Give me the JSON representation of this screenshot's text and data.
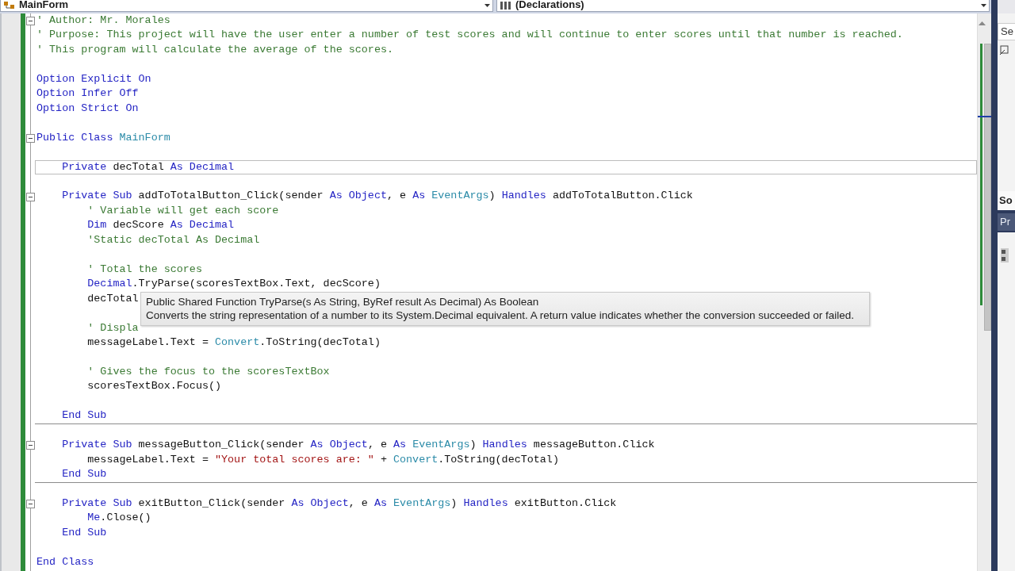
{
  "navigation_bar": {
    "type_combo": "MainForm",
    "member_combo": "(Declarations)"
  },
  "editor": {
    "lines": [
      {
        "kind": "code",
        "expanded": true,
        "tokens": [
          {
            "kind": "comment",
            "text": "' Author: Mr. Morales"
          }
        ]
      },
      {
        "kind": "code",
        "tokens": [
          {
            "kind": "comment",
            "text": "' Purpose: This project will have the user enter a number of test scores and will continue to enter scores until that number is reached."
          }
        ]
      },
      {
        "kind": "code",
        "tokens": [
          {
            "kind": "comment",
            "text": "' This program will calculate the average of the scores."
          }
        ]
      },
      {
        "kind": "blank"
      },
      {
        "kind": "code",
        "tokens": [
          {
            "kind": "keyword",
            "text": "Option Explicit On"
          }
        ]
      },
      {
        "kind": "code",
        "tokens": [
          {
            "kind": "keyword",
            "text": "Option Infer Off"
          }
        ]
      },
      {
        "kind": "code",
        "tokens": [
          {
            "kind": "keyword",
            "text": "Option Strict On"
          }
        ]
      },
      {
        "kind": "blank"
      },
      {
        "kind": "code",
        "expanded": true,
        "tokens": [
          {
            "kind": "keyword",
            "text": "Public Class "
          },
          {
            "kind": "type",
            "text": "MainForm"
          }
        ]
      },
      {
        "kind": "blank"
      },
      {
        "kind": "code",
        "current": true,
        "tokens": [
          {
            "kind": "keyword",
            "text": "    Private "
          },
          {
            "kind": "plain",
            "text": "decTotal "
          },
          {
            "kind": "keyword",
            "text": "As Decimal"
          }
        ]
      },
      {
        "kind": "blank"
      },
      {
        "kind": "code",
        "expanded": true,
        "tokens": [
          {
            "kind": "keyword",
            "text": "    Private Sub "
          },
          {
            "kind": "plain",
            "text": "addToTotalButton_Click(sender "
          },
          {
            "kind": "keyword",
            "text": "As Object"
          },
          {
            "kind": "plain",
            "text": ", e "
          },
          {
            "kind": "keyword",
            "text": "As "
          },
          {
            "kind": "type",
            "text": "EventArgs"
          },
          {
            "kind": "plain",
            "text": ") "
          },
          {
            "kind": "keyword",
            "text": "Handles "
          },
          {
            "kind": "plain",
            "text": "addToTotalButton.Click"
          }
        ]
      },
      {
        "kind": "code",
        "tokens": [
          {
            "kind": "comment",
            "text": "        ' Variable will get each score"
          }
        ]
      },
      {
        "kind": "code",
        "tokens": [
          {
            "kind": "keyword",
            "text": "        Dim "
          },
          {
            "kind": "plain",
            "text": "decScore "
          },
          {
            "kind": "keyword",
            "text": "As Decimal"
          }
        ]
      },
      {
        "kind": "code",
        "tokens": [
          {
            "kind": "comment",
            "text": "        'Static decTotal As Decimal"
          }
        ]
      },
      {
        "kind": "blank"
      },
      {
        "kind": "code",
        "tokens": [
          {
            "kind": "comment",
            "text": "        ' Total the scores"
          }
        ]
      },
      {
        "kind": "code",
        "tokens": [
          {
            "kind": "keyword",
            "text": "        Decimal"
          },
          {
            "kind": "plain",
            "text": ".TryParse(scoresTextBox.Text, decScore)"
          }
        ]
      },
      {
        "kind": "code",
        "tokens": [
          {
            "kind": "plain",
            "text": "        decTotal"
          }
        ]
      },
      {
        "kind": "blank"
      },
      {
        "kind": "code",
        "tokens": [
          {
            "kind": "comment",
            "text": "        ' Displa"
          }
        ]
      },
      {
        "kind": "code",
        "tokens": [
          {
            "kind": "plain",
            "text": "        messageLabel.Text = "
          },
          {
            "kind": "type",
            "text": "Convert"
          },
          {
            "kind": "plain",
            "text": ".ToString(decTotal)"
          }
        ]
      },
      {
        "kind": "blank"
      },
      {
        "kind": "code",
        "tokens": [
          {
            "kind": "comment",
            "text": "        ' Gives the focus to the scoresTextBox"
          }
        ]
      },
      {
        "kind": "code",
        "tokens": [
          {
            "kind": "plain",
            "text": "        scoresTextBox.Focus()"
          }
        ]
      },
      {
        "kind": "blank"
      },
      {
        "kind": "code",
        "tokens": [
          {
            "kind": "keyword",
            "text": "    End Sub"
          }
        ]
      },
      {
        "kind": "blank",
        "separator": true
      },
      {
        "kind": "code",
        "expanded": true,
        "tokens": [
          {
            "kind": "keyword",
            "text": "    Private Sub "
          },
          {
            "kind": "plain",
            "text": "messageButton_Click(sender "
          },
          {
            "kind": "keyword",
            "text": "As Object"
          },
          {
            "kind": "plain",
            "text": ", e "
          },
          {
            "kind": "keyword",
            "text": "As "
          },
          {
            "kind": "type",
            "text": "EventArgs"
          },
          {
            "kind": "plain",
            "text": ") "
          },
          {
            "kind": "keyword",
            "text": "Handles "
          },
          {
            "kind": "plain",
            "text": "messageButton.Click"
          }
        ]
      },
      {
        "kind": "code",
        "tokens": [
          {
            "kind": "plain",
            "text": "        messageLabel.Text = "
          },
          {
            "kind": "string",
            "text": "\"Your total scores are: \""
          },
          {
            "kind": "plain",
            "text": " + "
          },
          {
            "kind": "type",
            "text": "Convert"
          },
          {
            "kind": "plain",
            "text": ".ToString(decTotal)"
          }
        ]
      },
      {
        "kind": "code",
        "tokens": [
          {
            "kind": "keyword",
            "text": "    End Sub"
          }
        ]
      },
      {
        "kind": "blank",
        "separator": true
      },
      {
        "kind": "code",
        "expanded": true,
        "tokens": [
          {
            "kind": "keyword",
            "text": "    Private Sub "
          },
          {
            "kind": "plain",
            "text": "exitButton_Click(sender "
          },
          {
            "kind": "keyword",
            "text": "As Object"
          },
          {
            "kind": "plain",
            "text": ", e "
          },
          {
            "kind": "keyword",
            "text": "As "
          },
          {
            "kind": "type",
            "text": "EventArgs"
          },
          {
            "kind": "plain",
            "text": ") "
          },
          {
            "kind": "keyword",
            "text": "Handles "
          },
          {
            "kind": "plain",
            "text": "exitButton.Click"
          }
        ]
      },
      {
        "kind": "code",
        "tokens": [
          {
            "kind": "keyword",
            "text": "        Me"
          },
          {
            "kind": "plain",
            "text": ".Close()"
          }
        ]
      },
      {
        "kind": "code",
        "tokens": [
          {
            "kind": "keyword",
            "text": "    End Sub"
          }
        ]
      },
      {
        "kind": "blank"
      },
      {
        "kind": "code",
        "tokens": [
          {
            "kind": "keyword",
            "text": "End Class"
          }
        ]
      }
    ]
  },
  "quick_info": {
    "signature": "Public Shared Function TryParse(s As String, ByRef result As Decimal) As Boolean",
    "description": "Converts the string representation of a number to its System.Decimal equivalent. A return value indicates whether the conversion succeeded or failed."
  },
  "side_panel": {
    "search_text": "Se",
    "title": "So",
    "tab": "Pr"
  }
}
